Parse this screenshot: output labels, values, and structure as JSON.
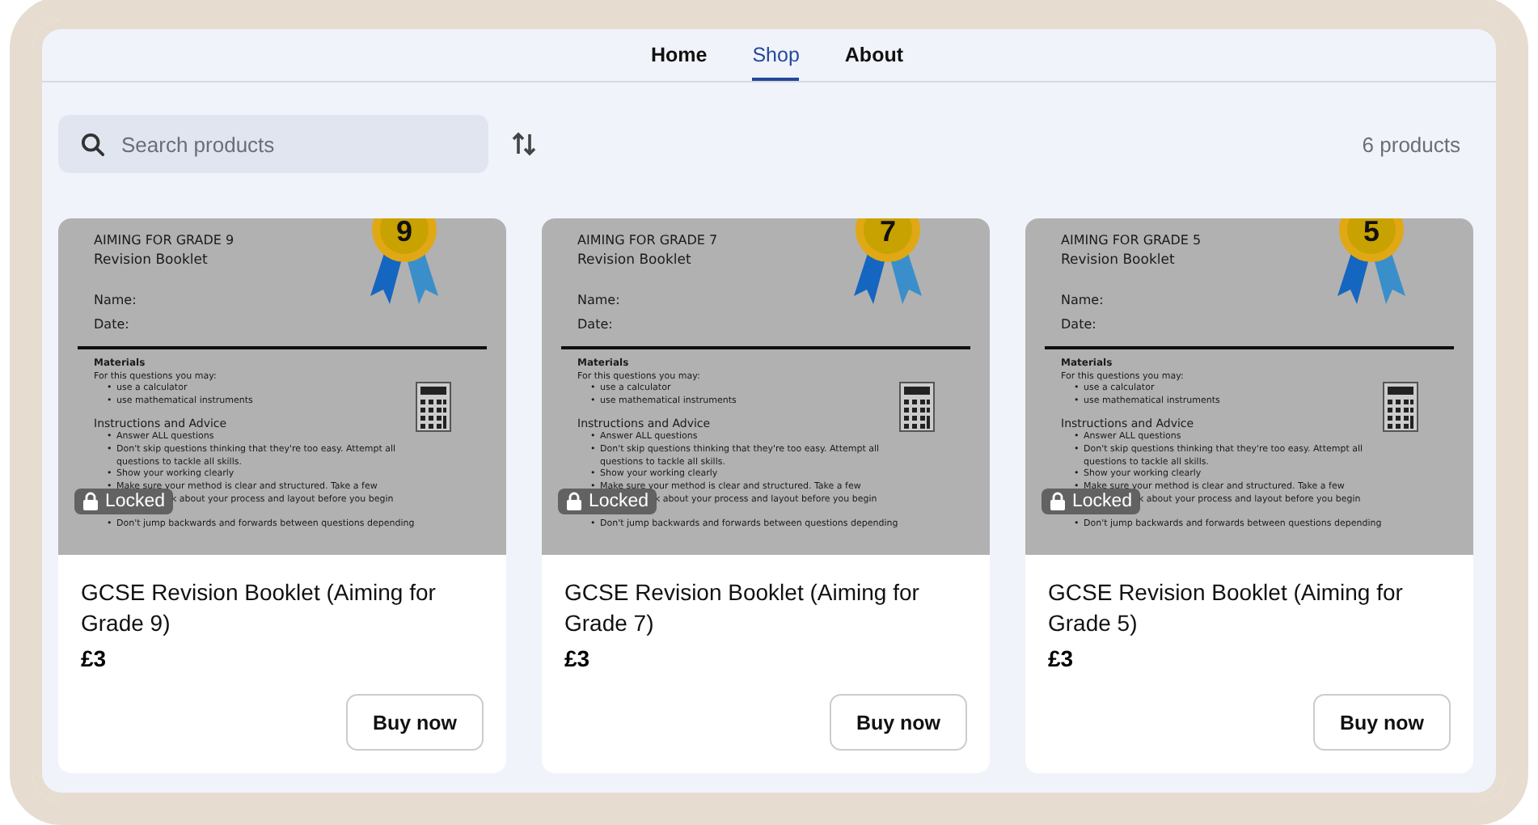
{
  "nav": {
    "items": [
      {
        "label": "Home",
        "selected": false
      },
      {
        "label": "Shop",
        "selected": true
      },
      {
        "label": "About",
        "selected": false
      }
    ]
  },
  "toolbar": {
    "search": {
      "placeholder": "Search products"
    },
    "count": "6 products"
  },
  "products": [
    {
      "image": {
        "badge": "9",
        "heading": "AIMING FOR GRADE 9",
        "subheading": "Revision Booklet",
        "fields": [
          "Name:",
          "Date:"
        ],
        "materials_title": "Materials",
        "materials_intro": "For this questions you may:",
        "materials": [
          {
            "bullet": "•",
            "text": "use a calculator"
          },
          {
            "bullet": "•",
            "text": "use mathematical instruments"
          }
        ],
        "advice_title": "Instructions and Advice",
        "advice": [
          {
            "bullet": "•",
            "text": "Answer ALL questions"
          },
          {
            "bullet": "•",
            "text": "Don't skip questions thinking that they're too easy. Attempt all"
          },
          {
            "text": "questions to tackle all skills."
          },
          {
            "bullet": "•",
            "text": "Show your working clearly"
          },
          {
            "bullet": "•",
            "text": "Make sure your method is clear and structured. Take a few"
          },
          {
            "kind": "covered",
            "text": "k about your process and layout before you begin"
          },
          {
            "bullet": "•",
            "text": "Don't jump backwards and forwards between questions depending"
          }
        ]
      },
      "locked": true,
      "lock_label": "Locked",
      "title": "GCSE Revision Booklet (Aiming for Grade 9)",
      "price": "£3",
      "button": "Buy now"
    },
    {
      "image": {
        "badge": "7",
        "heading": "AIMING FOR GRADE 7",
        "subheading": "Revision Booklet",
        "fields": [
          "Name:",
          "Date:"
        ],
        "materials_title": "Materials",
        "materials_intro": "For this questions you may:",
        "materials": [
          {
            "bullet": "•",
            "text": "use a calculator"
          },
          {
            "bullet": "•",
            "text": "use mathematical instruments"
          }
        ],
        "advice_title": "Instructions and Advice",
        "advice": [
          {
            "bullet": "•",
            "text": "Answer ALL questions"
          },
          {
            "bullet": "•",
            "text": "Don't skip questions thinking that they're too easy. Attempt all"
          },
          {
            "text": "questions to tackle all skills."
          },
          {
            "bullet": "•",
            "text": "Show your working clearly"
          },
          {
            "bullet": "•",
            "text": "Make sure your method is clear and structured. Take a few"
          },
          {
            "kind": "covered",
            "text": "k about your process and layout before you begin"
          },
          {
            "bullet": "•",
            "text": "Don't jump backwards and forwards between questions depending"
          }
        ]
      },
      "locked": true,
      "lock_label": "Locked",
      "title": "GCSE Revision Booklet (Aiming for Grade 7)",
      "price": "£3",
      "button": "Buy now"
    },
    {
      "image": {
        "badge": "5",
        "heading": "AIMING FOR GRADE 5",
        "subheading": "Revision Booklet",
        "fields": [
          "Name:",
          "Date:"
        ],
        "materials_title": "Materials",
        "materials_intro": "For this questions you may:",
        "materials": [
          {
            "bullet": "•",
            "text": "use a calculator"
          },
          {
            "bullet": "•",
            "text": "use mathematical instruments"
          }
        ],
        "advice_title": "Instructions and Advice",
        "advice": [
          {
            "bullet": "•",
            "text": "Answer ALL questions"
          },
          {
            "bullet": "•",
            "text": "Don't skip questions thinking that they're too easy. Attempt all"
          },
          {
            "text": "questions to tackle all skills."
          },
          {
            "bullet": "•",
            "text": "Show your working clearly"
          },
          {
            "bullet": "•",
            "text": "Make sure your method is clear and structured. Take a few"
          },
          {
            "kind": "covered",
            "text": "k about your process and layout before you begin"
          },
          {
            "bullet": "•",
            "text": "Don't jump backwards and forwards between questions depending"
          }
        ]
      },
      "locked": true,
      "lock_label": "Locked",
      "title": "GCSE Revision Booklet (Aiming for Grade 5)",
      "price": "£3",
      "button": "Buy now"
    }
  ]
}
